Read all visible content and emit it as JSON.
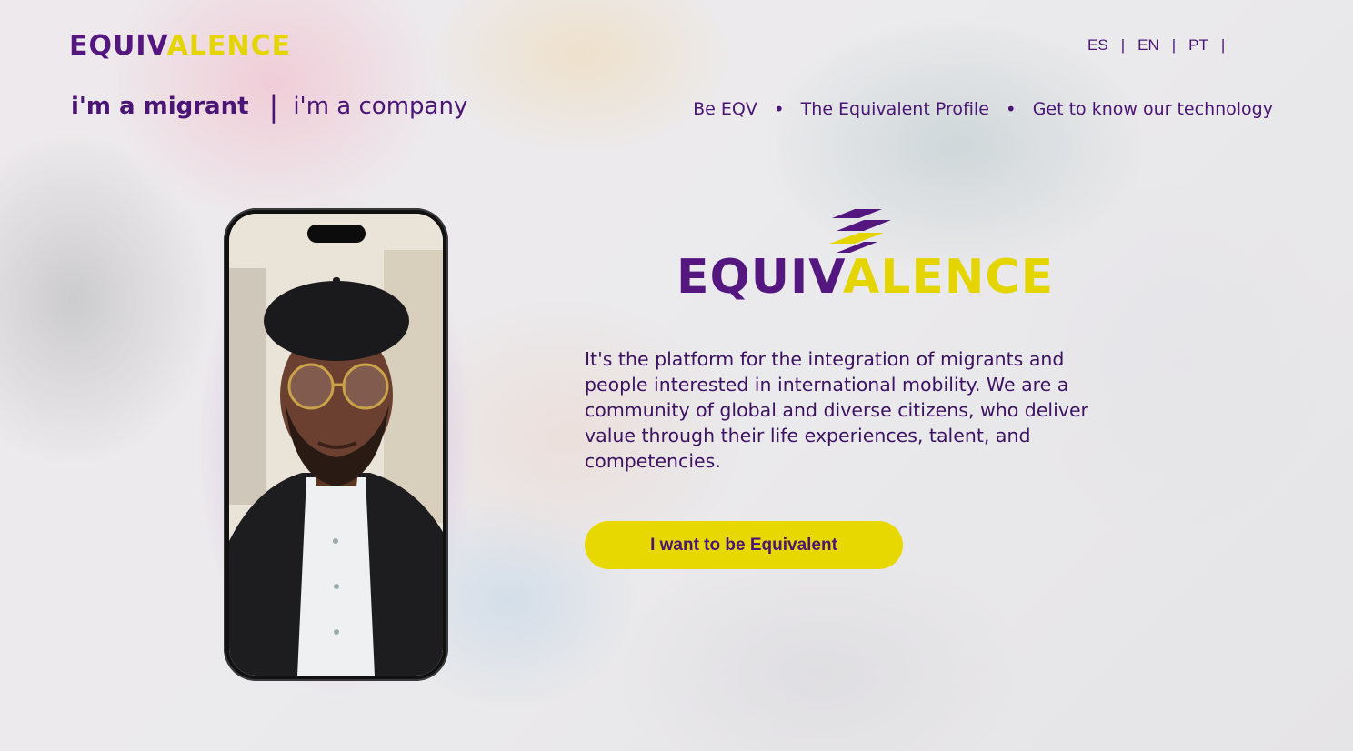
{
  "brand": {
    "name_part1": "EQUIV",
    "name_part2": "ALENCE"
  },
  "languages": [
    {
      "label": "ES"
    },
    {
      "label": "EN"
    },
    {
      "label": "PT"
    }
  ],
  "language_separator": "|",
  "audience_switcher": {
    "migrant": "i'm a migrant",
    "separator": "|",
    "company": "i'm a company"
  },
  "nav": {
    "items": [
      "Be EQV",
      "The Equivalent Profile",
      "Get to know our technology"
    ],
    "bullet": "•"
  },
  "hero": {
    "description": "It's the platform for the integration of migrants and people interested in international mobility. We are a community of global and diverse citizens, who deliver value through their life experiences, talent, and competencies.",
    "cta_label": "I want to be Equivalent"
  },
  "colors": {
    "brand_purple": "#54177f",
    "brand_yellow": "#e4d500",
    "text_purple": "#4b1576"
  },
  "icons": {
    "brand_mark": "equivalence-stripes-icon"
  }
}
